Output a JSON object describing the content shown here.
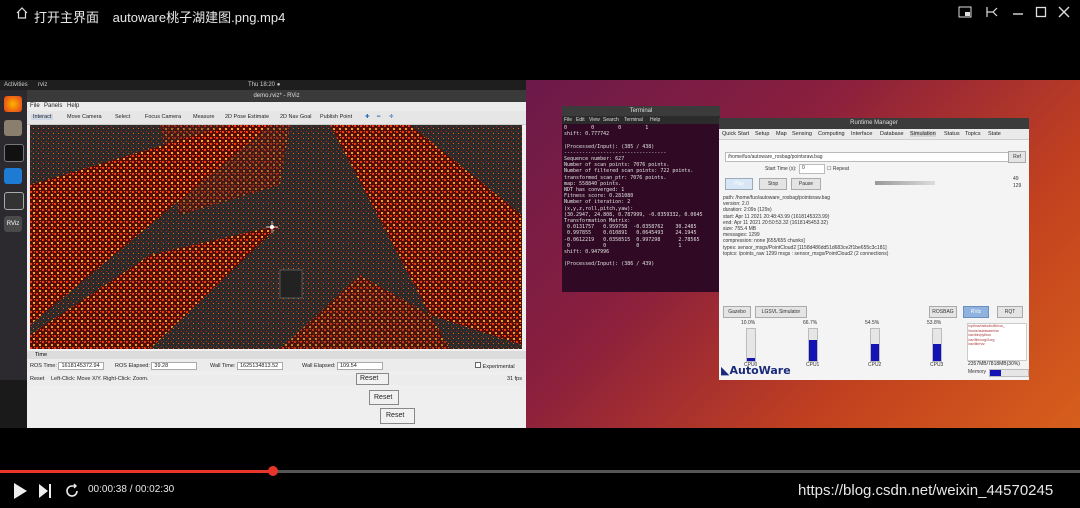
{
  "player": {
    "title": "打开主界面",
    "filename": "autoware桃子湖建图.png.mp4",
    "time_current": "00:00:38",
    "time_total": "00:02:30",
    "progress": 0.253,
    "watermark": "https://blog.csdn.net/weixin_44570245"
  },
  "ubuntu": {
    "activities": "Activities",
    "app": "rviz",
    "clock": "Thu 18:20 ●"
  },
  "rviz": {
    "window_title": "demo.rviz* - RViz",
    "menu": [
      "File",
      "Panels",
      "Help"
    ],
    "tools": [
      "Interact",
      "Move Camera",
      "Select",
      "Focus Camera",
      "Measure",
      "2D Pose Estimate",
      "2D Nav Goal",
      "Publish Point"
    ],
    "time_panel": "Time",
    "ros_time_label": "ROS Time:",
    "ros_time": "1618145372.94",
    "ros_elapsed_label": "ROS Elapsed:",
    "ros_elapsed": "39.28",
    "wall_time_label": "Wall Time:",
    "wall_time": "1625134813.52",
    "wall_elapsed_label": "Wall Elapsed:",
    "wall_elapsed": "109.54",
    "experimental": "Experimental",
    "reset": "Reset",
    "status_help": "Left-Click: Move X/Y. Right-Click: Zoom.",
    "fps": "31 fps"
  },
  "reset_buttons": [
    "Reset",
    "Reset",
    "Reset"
  ],
  "terminal": {
    "title": "Terminal",
    "menu": [
      "File",
      "Edit",
      "View",
      "Search",
      "Terminal",
      "Help"
    ],
    "lines": [
      "0        0        0        1",
      "shift: 0.777742",
      "",
      "(Processed/Input): (385 / 438)",
      "----------------------------------",
      "Sequence number: 627",
      "Number of scan points: 7076 points.",
      "Number of filtered scan points: 722 points.",
      "transformed_scan_ptr: 7076 points.",
      "map: 558840 points.",
      "NDT has converged: 1",
      "Fitness score: 0.281080",
      "Number of iteration: 2",
      "(x,y,z,roll,pitch,yaw):",
      "(30.2947, 24.808, 0.787999, -0.0359332, 0.0645",
      "Transformation Matrix:",
      " 0.0131757   0.959758  -0.0358762    30.2485",
      " 0.997855    0.010891   0.0645493    24.1945",
      "-0.0612219   0.0358515  0.997298      2.78565",
      " 0           0          0             1",
      "shift: 0.947996",
      "",
      "(Processed/Input): (386 / 439)"
    ]
  },
  "runtime_manager": {
    "title": "Runtime Manager",
    "tabs": [
      "Quick Start",
      "Setup",
      "Map",
      "Sensing",
      "Computing",
      "Interface",
      "Database",
      "Simulation",
      "Status",
      "Topics",
      "State"
    ],
    "bag_path": "/home/fuo/autoware_rosbag/pointsraw.bag",
    "ref_button": "Ref",
    "start_time_label": "Start Time (s):",
    "start_time": "0",
    "repeat_label": "Repeat",
    "play_button": "Play",
    "stop_button": "Stop",
    "pause_button": "Pause",
    "progress_numbers": [
      "49",
      "129"
    ],
    "info_lines": [
      "path:        /home/fuo/autoware_rosbag/pointsraw.bag",
      "version:     2.0",
      "duration:    2:09s (129s)",
      "start:       Apr 11 2021 20:48:43.99 (1618145323.99)",
      "end:         Apr 11 2021 20:50:53.32 (1618145453.32)",
      "size:        755.4 MB",
      "messages:    1299",
      "compression: none [655/655 chunks]",
      "types:       sensor_msgs/PointCloud2 [1158d486dd51d683ce2f1be655c3c181]",
      "topics:      /points_raw   1299 msgs  : sensor_msgs/PointCloud2 (2 connections)"
    ],
    "bottom_buttons": [
      "Gazebo",
      "LGSVL Simulator",
      "ROSBAG",
      "RViz",
      "RQT"
    ],
    "cpus": [
      {
        "label": "CPU0",
        "percent": "10.0%",
        "value": 10.0
      },
      {
        "label": "CPU1",
        "percent": "66.7%",
        "value": 66.7
      },
      {
        "label": "CPU2",
        "percent": "54.5%",
        "value": 54.5
      },
      {
        "label": "CPU3",
        "percent": "53.8%",
        "value": 53.8
      }
    ],
    "memory_text": "2357MB/7818MB(30%)",
    "memory_label": "Memory",
    "memory_fraction": 0.3,
    "logo_text": "AutoWare"
  },
  "colors": {
    "progress": "#e8352a",
    "cpu_bar": "#1414b4",
    "terminal_bg": "#300a24"
  }
}
